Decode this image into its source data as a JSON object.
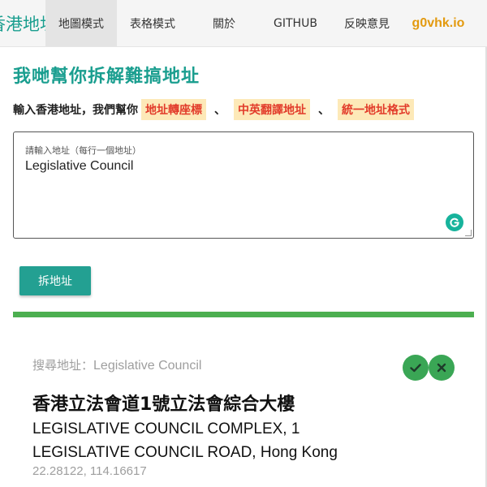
{
  "nav": {
    "brand": "香港地址",
    "items": [
      {
        "label": "地圖模式",
        "active": true
      },
      {
        "label": "表格模式",
        "active": false
      },
      {
        "label": "關於",
        "active": false
      },
      {
        "label": "GITHUB",
        "active": false
      },
      {
        "label": "反映意見",
        "active": false
      }
    ],
    "logo": "g0vhk.io"
  },
  "hero": {
    "title": "我哋幫你拆解難搞地址",
    "lead": "輸入香港地址，我們幫你",
    "tags": [
      "地址轉座標",
      "中英翻譯地址",
      "統一地址格式"
    ],
    "separator": "、"
  },
  "input": {
    "label": "請輸入地址（每行一個地址）",
    "value": "Legislative Council"
  },
  "actions": {
    "split_label": "拆地址"
  },
  "result": {
    "search_prefix": "搜尋地址：",
    "search_value": "Legislative Council",
    "zh_address": "香港立法會道1號立法會綜合大樓",
    "en_address": "LEGISLATIVE COUNCIL COMPLEX, 1 LEGISLATIVE COUNCIL ROAD, Hong Kong",
    "coordinates": "22.28122, 114.16617"
  },
  "icons": {
    "confirm": "check-icon",
    "reject": "close-icon",
    "grammarly": "grammarly-icon"
  },
  "colors": {
    "primary": "#1a9e8f",
    "tag_bg": "#fde9b8",
    "tag_text": "#e23b2a",
    "divider": "#4caf50",
    "logo": "#e39a0f"
  }
}
